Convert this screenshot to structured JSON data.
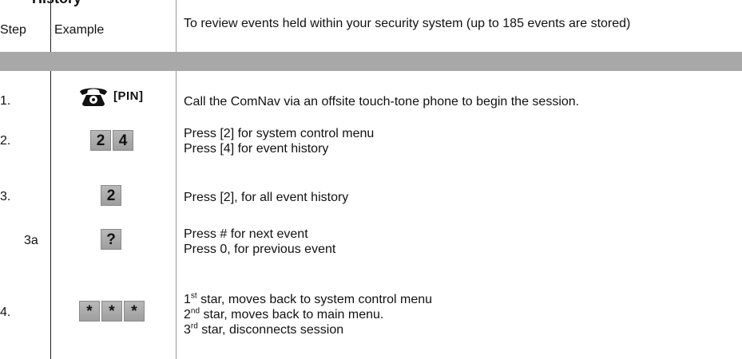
{
  "section_title_partial": "History",
  "header": {
    "step": "Step",
    "example": "Example",
    "description": "To review events held within your security system (up to 185 events are stored)"
  },
  "rows": [
    {
      "step": "1.",
      "example_keys": [],
      "example_extra": "[PIN]",
      "icon": "phone-icon",
      "description": [
        "Call the ComNav via an offsite touch-tone phone to begin the session."
      ]
    },
    {
      "step": "2.",
      "example_keys": [
        "2",
        "4"
      ],
      "description": [
        "Press [2] for system control menu",
        "Press [4] for event history"
      ]
    },
    {
      "step": "3.",
      "example_keys": [
        "2"
      ],
      "description": [
        "Press [2], for all event history"
      ]
    },
    {
      "step": "3a",
      "example_keys": [
        "?"
      ],
      "description": [
        "Press # for next event",
        "Press 0, for previous event"
      ]
    },
    {
      "step": "4.",
      "example_keys": [
        "*",
        "*",
        "*"
      ],
      "description": [
        {
          "ordinal": "1",
          "sup": "st",
          "text": " star, moves back to system control menu"
        },
        {
          "ordinal": "2",
          "sup": "nd",
          "text": " star, moves back to main menu."
        },
        {
          "ordinal": "3",
          "sup": "rd",
          "text": " star, disconnects session"
        }
      ]
    }
  ]
}
